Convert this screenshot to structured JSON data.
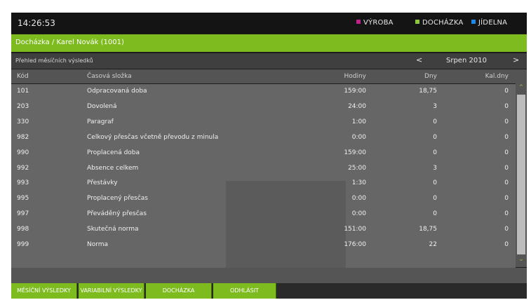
{
  "clock": "14:26:53",
  "modules": [
    {
      "label": "VÝROBA",
      "color": "#c0208c"
    },
    {
      "label": "DOCHÁZKA",
      "color": "#8ec63f"
    },
    {
      "label": "JÍDELNA",
      "color": "#1e88e5"
    }
  ],
  "header": {
    "title": "Docházka / Karel Novák (1001)"
  },
  "subheader": {
    "title": "Přehled měsíčních výsledků",
    "prev": "<",
    "month": "Srpen 2010",
    "next": ">"
  },
  "table": {
    "columns": [
      "Kód",
      "Časová složka",
      "Hodiny",
      "Dny",
      "Kal.dny"
    ],
    "rows": [
      {
        "kod": "101",
        "slozka": "Odpracovaná doba",
        "hodiny": "159:00",
        "dny": "18,75",
        "kal": "0"
      },
      {
        "kod": "203",
        "slozka": "Dovolená",
        "hodiny": "24:00",
        "dny": "3",
        "kal": "0"
      },
      {
        "kod": "330",
        "slozka": "Paragraf",
        "hodiny": "1:00",
        "dny": "0",
        "kal": "0"
      },
      {
        "kod": "982",
        "slozka": "Celkový přesčas včetně převodu z minula",
        "hodiny": "0:00",
        "dny": "0",
        "kal": "0"
      },
      {
        "kod": "990",
        "slozka": "Proplacená doba",
        "hodiny": "159:00",
        "dny": "0",
        "kal": "0"
      },
      {
        "kod": "992",
        "slozka": "Absence celkem",
        "hodiny": "25:00",
        "dny": "3",
        "kal": "0"
      },
      {
        "kod": "993",
        "slozka": "Přestávky",
        "hodiny": "1:30",
        "dny": "0",
        "kal": "0"
      },
      {
        "kod": "995",
        "slozka": "Proplacený přesčas",
        "hodiny": "0:00",
        "dny": "0",
        "kal": "0"
      },
      {
        "kod": "997",
        "slozka": "Převáděný přesčas",
        "hodiny": "0:00",
        "dny": "0",
        "kal": "0"
      },
      {
        "kod": "998",
        "slozka": "Skutečná norma",
        "hodiny": "151:00",
        "dny": "18,75",
        "kal": "0"
      },
      {
        "kod": "999",
        "slozka": "Norma",
        "hodiny": "176:00",
        "dny": "22",
        "kal": "0"
      }
    ]
  },
  "scrollbar": {
    "up_icon": "chevron-up-icon",
    "down_icon": "chevron-down-icon"
  },
  "nav": [
    "MĚSÍČNÍ VÝSLEDKY",
    "VARIABILNÍ VÝSLEDKY",
    "DOCHÁZKA",
    "ODHLÁSIT"
  ],
  "colors": {
    "accent": "#7dbb1f",
    "background": "#1c1c1c",
    "table_bg": "#666666"
  }
}
